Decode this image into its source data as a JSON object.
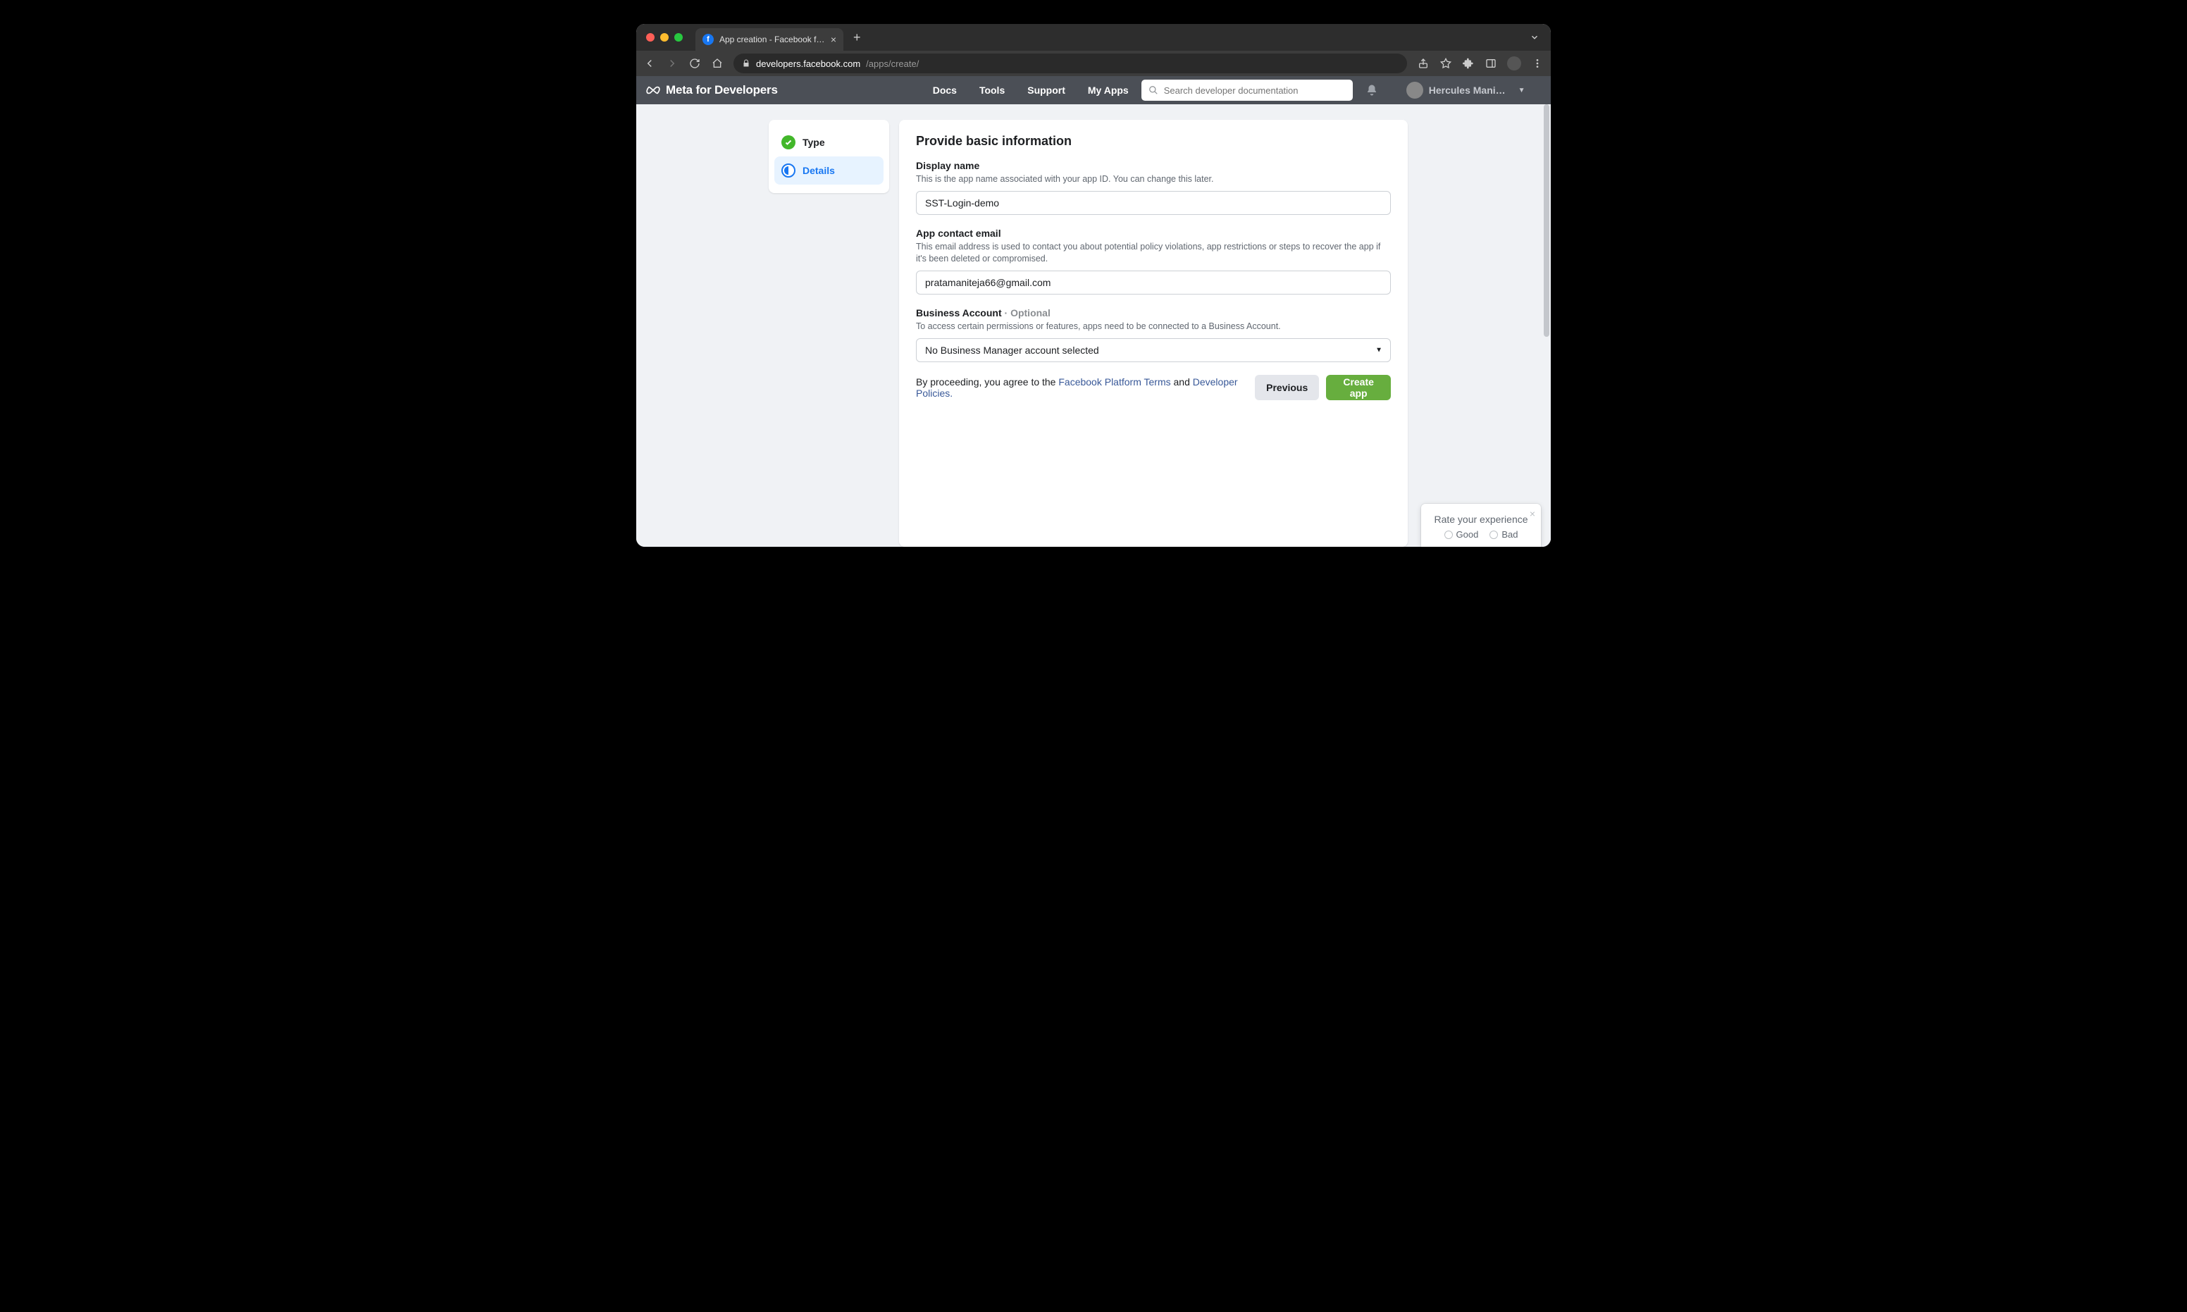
{
  "browser": {
    "tab_title": "App creation - Facebook for De",
    "url_host": "developers.facebook.com",
    "url_path": "/apps/create/"
  },
  "meta_header": {
    "brand": "Meta for Developers",
    "nav": {
      "docs": "Docs",
      "tools": "Tools",
      "support": "Support",
      "myapps": "My Apps"
    },
    "search_placeholder": "Search developer documentation",
    "user_name": "Hercules Mani…"
  },
  "steps": {
    "type": "Type",
    "details": "Details"
  },
  "form": {
    "heading": "Provide basic information",
    "display_name": {
      "label": "Display name",
      "desc": "This is the app name associated with your app ID. You can change this later.",
      "value": "SST-Login-demo"
    },
    "contact_email": {
      "label": "App contact email",
      "desc": "This email address is used to contact you about potential policy violations, app restrictions or steps to recover the app if it's been deleted or compromised.",
      "value": "pratamaniteja66@gmail.com"
    },
    "business_account": {
      "label": "Business Account",
      "optional": "Optional",
      "desc": "To access certain permissions or features, apps need to be connected to a Business Account.",
      "value": "No Business Manager account selected"
    },
    "agree_prefix": "By proceeding, you agree to the ",
    "agree_link1": "Facebook Platform Terms",
    "agree_and": " and ",
    "agree_link2": "Developer Policies.",
    "btn_prev": "Previous",
    "btn_create": "Create app"
  },
  "feedback": {
    "title": "Rate your experience",
    "good": "Good",
    "bad": "Bad"
  }
}
